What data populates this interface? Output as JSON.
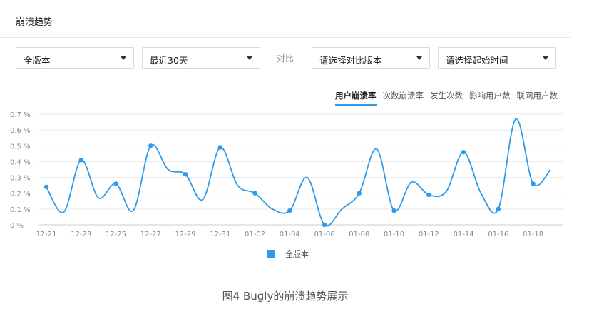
{
  "header": {
    "title": "崩溃趋势"
  },
  "filters": {
    "version": "全版本",
    "range": "最近30天",
    "compare_label": "对比",
    "compare_version": "请选择对比版本",
    "start_time": "请选择起始时间"
  },
  "tabs": [
    "用户崩溃率",
    "次数崩溃率",
    "发生次数",
    "影响用户数",
    "联网用户数"
  ],
  "legend": {
    "label": "全版本"
  },
  "caption": "图4 Bugly的崩溃趋势展示",
  "colors": {
    "accent": "#2f9be8",
    "grid": "#e9e9e9",
    "axis_text": "#888888"
  },
  "chart_data": {
    "type": "line",
    "xlabel": "",
    "ylabel": "",
    "ylim": [
      0,
      0.7
    ],
    "yticks": [
      0,
      0.1,
      0.2,
      0.3,
      0.4,
      0.5,
      0.6,
      0.7
    ],
    "ytick_labels": [
      "0 %",
      "0.1 %",
      "0.2 %",
      "0.3 %",
      "0.4 %",
      "0.5 %",
      "0.6 %",
      "0.7 %"
    ],
    "categories": [
      "12-21",
      "12-22",
      "12-23",
      "12-24",
      "12-25",
      "12-26",
      "12-27",
      "12-28",
      "12-29",
      "12-30",
      "12-31",
      "01-01",
      "01-02",
      "01-03",
      "01-04",
      "01-05",
      "01-06",
      "01-07",
      "01-08",
      "01-09",
      "01-10",
      "01-11",
      "01-12",
      "01-13",
      "01-14",
      "01-15",
      "01-16",
      "01-17",
      "01-18",
      "01-19"
    ],
    "xtick_labels": [
      "12-21",
      "12-23",
      "12-25",
      "12-27",
      "12-29",
      "12-31",
      "01-02",
      "01-04",
      "01-06",
      "01-08",
      "01-10",
      "01-12",
      "01-14",
      "01-16",
      "01-18"
    ],
    "grid": true,
    "legend_position": "bottom",
    "series": [
      {
        "name": "全版本",
        "values": [
          0.24,
          0.08,
          0.41,
          0.17,
          0.26,
          0.09,
          0.5,
          0.35,
          0.32,
          0.16,
          0.49,
          0.25,
          0.2,
          0.1,
          0.09,
          0.3,
          0.0,
          0.1,
          0.2,
          0.48,
          0.09,
          0.27,
          0.19,
          0.21,
          0.46,
          0.2,
          0.1,
          0.67,
          0.26,
          0.35
        ]
      }
    ]
  }
}
